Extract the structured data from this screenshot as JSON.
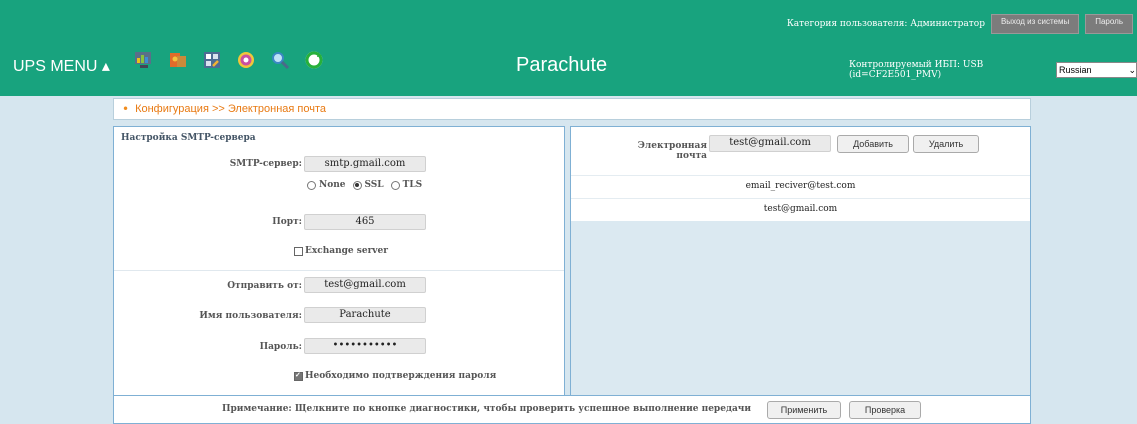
{
  "header": {
    "user_category": "Категория пользователя: Администратор",
    "logout_label": "Выход из системы",
    "password_label": "Пароль",
    "menu_title": "UPS MENU ▴",
    "brand": "Parachute",
    "ups_info": "Контролируемый ИБП: USB (id=CF2E501_PMV)",
    "language": "Russian",
    "icons": [
      "monitor-chart-icon",
      "settings-box-icon",
      "tools-icon",
      "target-icon",
      "search-icon",
      "refresh-icon"
    ]
  },
  "breadcrumb": "Конфигурация >> Электронная почта",
  "smtp": {
    "section_title": "Настройка SMTP-сервера",
    "server_label": "SMTP-сервер:",
    "server_value": "smtp.gmail.com",
    "security_options": [
      "None",
      "SSL",
      "TLS"
    ],
    "security_selected": "SSL",
    "port_label": "Порт:",
    "port_value": "465",
    "exchange_label": "Exchange server",
    "from_label": "Отправить от:",
    "from_value": "test@gmail.com",
    "username_label": "Имя пользователя:",
    "username_value": "Parachute",
    "password_label": "Пароль:",
    "password_value": "•••••••••••",
    "confirm_label": "Необходимо подтверждения пароля"
  },
  "email": {
    "label": "Электронная почта",
    "input_value": "test@gmail.com",
    "add_label": "Добавить",
    "delete_label": "Удалить",
    "list": [
      "email_reciver@test.com",
      "test@gmail.com"
    ]
  },
  "footer": {
    "note": "Примечание:    Щелкните по кнопке диагностики, чтобы проверить успешное выполнение передачи",
    "apply_label": "Применить",
    "test_label": "Проверка"
  },
  "colors": {
    "header_bg": "#18a37e",
    "breadcrumb_text": "#e87a13",
    "page_bg": "#d6e6ef"
  }
}
